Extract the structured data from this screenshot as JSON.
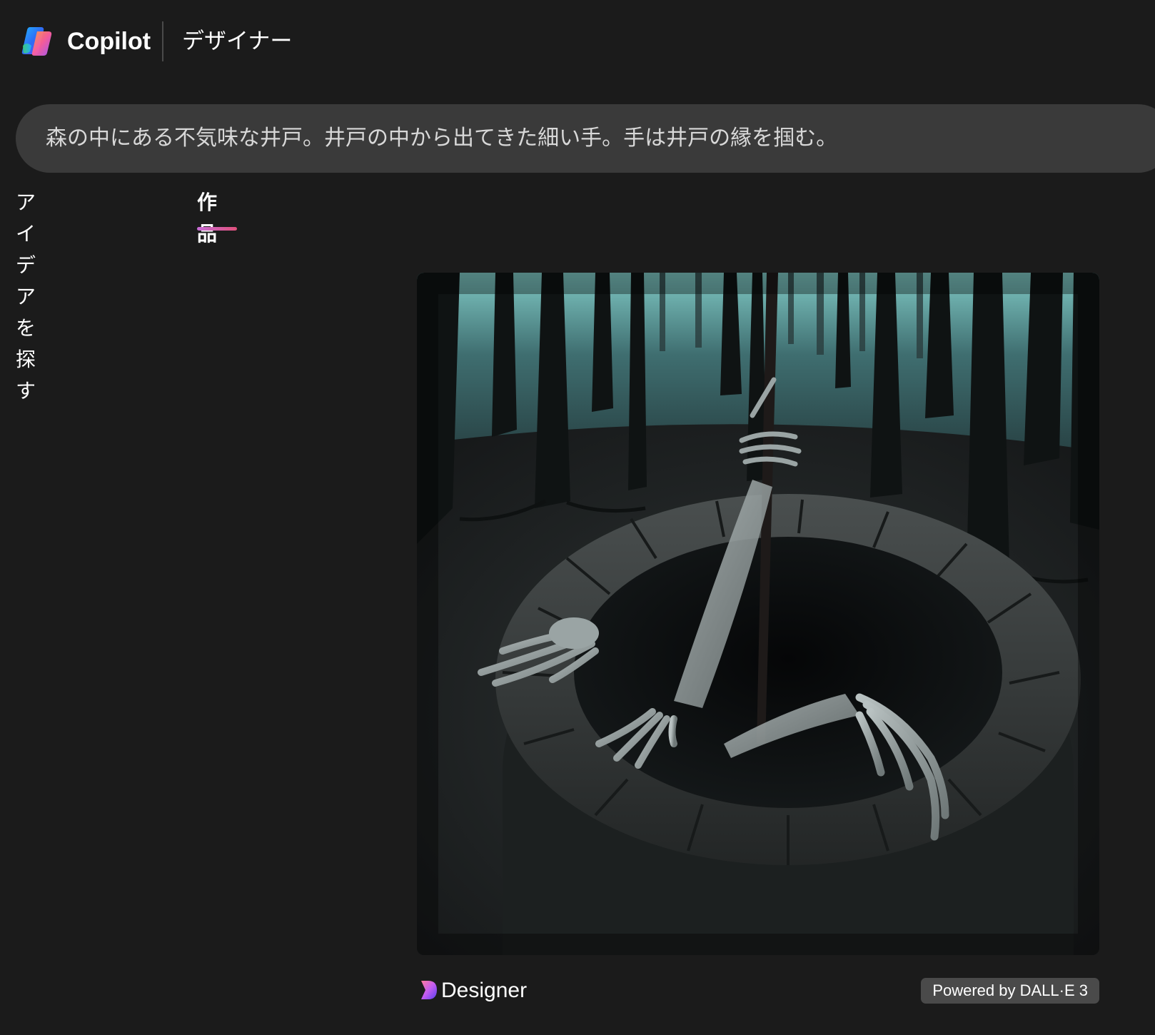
{
  "header": {
    "app_name": "Copilot",
    "product_name": "デザイナー"
  },
  "prompt": {
    "text": "森の中にある不気味な井戸。井戸の中から出てきた細い手。手は井戸の縁を掴む。"
  },
  "tabs": [
    {
      "label": "アイデアを探す",
      "active": false
    },
    {
      "label": "作品",
      "active": true
    }
  ],
  "result": {
    "image_icon": "generated-image",
    "brand_label": "Designer",
    "powered_by": "Powered by DALL·E 3"
  },
  "colors": {
    "background": "#1b1b1b",
    "prompt_bar": "#3a3a3a",
    "tab_accent_start": "#c86dd7",
    "tab_accent_end": "#e0507a",
    "badge": "#4a4a4a"
  }
}
